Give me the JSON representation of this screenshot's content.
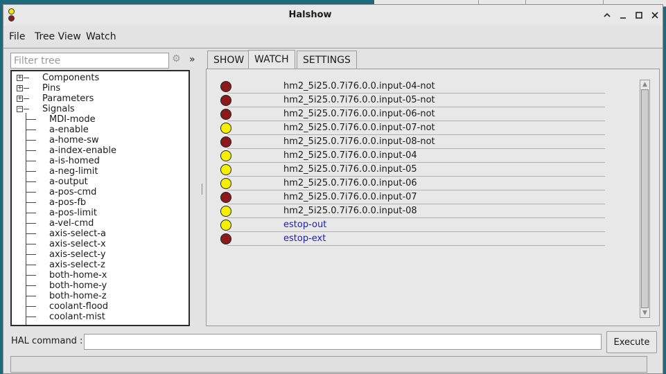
{
  "window": {
    "title": "Halshow",
    "controls": [
      "chevron-up-icon",
      "minimize-icon",
      "maximize-icon",
      "close-icon"
    ]
  },
  "menu": {
    "items": [
      {
        "label": "File"
      },
      {
        "label": "Tree View"
      },
      {
        "label": "Watch"
      }
    ]
  },
  "filter": {
    "placeholder": "Filter tree",
    "value": "",
    "chevron": "»"
  },
  "tree": {
    "roots": [
      {
        "label": "Components",
        "expanded": false
      },
      {
        "label": "Pins",
        "expanded": false
      },
      {
        "label": "Parameters",
        "expanded": false
      },
      {
        "label": "Signals",
        "expanded": true
      }
    ],
    "signals": [
      "MDI-mode",
      "a-enable",
      "a-home-sw",
      "a-index-enable",
      "a-is-homed",
      "a-neg-limit",
      "a-output",
      "a-pos-cmd",
      "a-pos-fb",
      "a-pos-limit",
      "a-vel-cmd",
      "axis-select-a",
      "axis-select-x",
      "axis-select-y",
      "axis-select-z",
      "both-home-x",
      "both-home-y",
      "both-home-z",
      "coolant-flood",
      "coolant-mist"
    ]
  },
  "tabs": [
    {
      "label": "SHOW",
      "active": false
    },
    {
      "label": "WATCH",
      "active": true
    },
    {
      "label": "SETTINGS",
      "active": false
    }
  ],
  "watch": {
    "colors": {
      "on": "#f5f000",
      "off": "#8b1a1a"
    },
    "items": [
      {
        "name": "hm2_5i25.0.7i76.0.0.input-04-not",
        "state": "off",
        "signal": false
      },
      {
        "name": "hm2_5i25.0.7i76.0.0.input-05-not",
        "state": "off",
        "signal": false
      },
      {
        "name": "hm2_5i25.0.7i76.0.0.input-06-not",
        "state": "off",
        "signal": false
      },
      {
        "name": "hm2_5i25.0.7i76.0.0.input-07-not",
        "state": "on",
        "signal": false
      },
      {
        "name": "hm2_5i25.0.7i76.0.0.input-08-not",
        "state": "off",
        "signal": false
      },
      {
        "name": "hm2_5i25.0.7i76.0.0.input-04",
        "state": "on",
        "signal": false
      },
      {
        "name": "hm2_5i25.0.7i76.0.0.input-05",
        "state": "on",
        "signal": false
      },
      {
        "name": "hm2_5i25.0.7i76.0.0.input-06",
        "state": "on",
        "signal": false
      },
      {
        "name": "hm2_5i25.0.7i76.0.0.input-07",
        "state": "off",
        "signal": false
      },
      {
        "name": "hm2_5i25.0.7i76.0.0.input-08",
        "state": "on",
        "signal": false
      },
      {
        "name": "estop-out",
        "state": "on",
        "signal": true
      },
      {
        "name": "estop-ext",
        "state": "off",
        "signal": true
      }
    ]
  },
  "command": {
    "label": "HAL command :",
    "value": "",
    "execute_label": "Execute"
  },
  "status": {
    "text": ""
  }
}
